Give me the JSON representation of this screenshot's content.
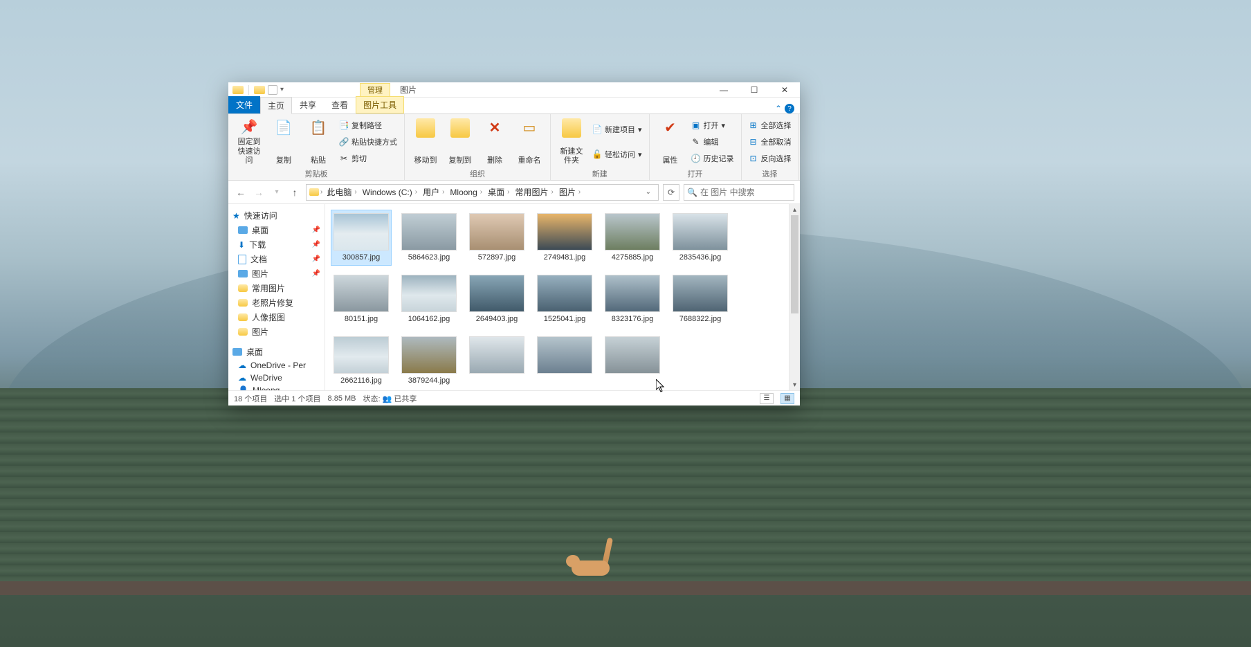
{
  "titlebar": {
    "context_tab": "管理",
    "title": "图片"
  },
  "tabs": {
    "file": "文件",
    "home": "主页",
    "share": "共享",
    "view": "查看",
    "picture_tools": "图片工具"
  },
  "ribbon": {
    "pin": "固定到快速访问",
    "copy": "复制",
    "paste": "粘贴",
    "copy_path": "复制路径",
    "paste_shortcut": "粘贴快捷方式",
    "cut": "剪切",
    "clipboard_group": "剪贴板",
    "move_to": "移动到",
    "copy_to": "复制到",
    "delete": "删除",
    "rename": "重命名",
    "organize_group": "组织",
    "new_folder": "新建文件夹",
    "new_item": "新建项目",
    "easy_access": "轻松访问",
    "new_group": "新建",
    "properties": "属性",
    "open": "打开",
    "edit": "编辑",
    "history": "历史记录",
    "open_group": "打开",
    "select_all": "全部选择",
    "select_none": "全部取消",
    "invert_selection": "反向选择",
    "select_group": "选择"
  },
  "addressbar": {
    "crumbs": [
      "此电脑",
      "Windows (C:)",
      "用户",
      "Mloong",
      "桌面",
      "常用图片",
      "图片"
    ]
  },
  "search": {
    "placeholder": "在 图片 中搜索"
  },
  "nav": {
    "quick_access": "快速访问",
    "desktop": "桌面",
    "downloads": "下载",
    "documents": "文档",
    "pictures": "图片",
    "common_pics": "常用图片",
    "old_photo_repair": "老照片修复",
    "portrait_matting": "人像抠图",
    "pictures2": "图片",
    "desktop2": "桌面",
    "onedrive": "OneDrive - Per",
    "wedrive": "WeDrive",
    "mloong": "Mloong"
  },
  "files": [
    {
      "name": "300857.jpg",
      "cls": "t1",
      "selected": true
    },
    {
      "name": "5864623.jpg",
      "cls": "t2"
    },
    {
      "name": "572897.jpg",
      "cls": "t3"
    },
    {
      "name": "2749481.jpg",
      "cls": "t4"
    },
    {
      "name": "4275885.jpg",
      "cls": "t5"
    },
    {
      "name": "2835436.jpg",
      "cls": "t6"
    },
    {
      "name": "80151.jpg",
      "cls": "t7"
    },
    {
      "name": "1064162.jpg",
      "cls": "t8"
    },
    {
      "name": "2649403.jpg",
      "cls": "t9"
    },
    {
      "name": "1525041.jpg",
      "cls": "t10"
    },
    {
      "name": "8323176.jpg",
      "cls": "t11"
    },
    {
      "name": "7688322.jpg",
      "cls": "t12"
    },
    {
      "name": "2662116.jpg",
      "cls": "t13"
    },
    {
      "name": "3879244.jpg",
      "cls": "t14"
    },
    {
      "name": "",
      "cls": "t15"
    },
    {
      "name": "",
      "cls": "t16"
    },
    {
      "name": "",
      "cls": "t17"
    }
  ],
  "status": {
    "item_count": "18 个项目",
    "selected": "选中 1 个项目",
    "size": "8.85 MB",
    "state_label": "状态:",
    "shared": "已共享"
  }
}
